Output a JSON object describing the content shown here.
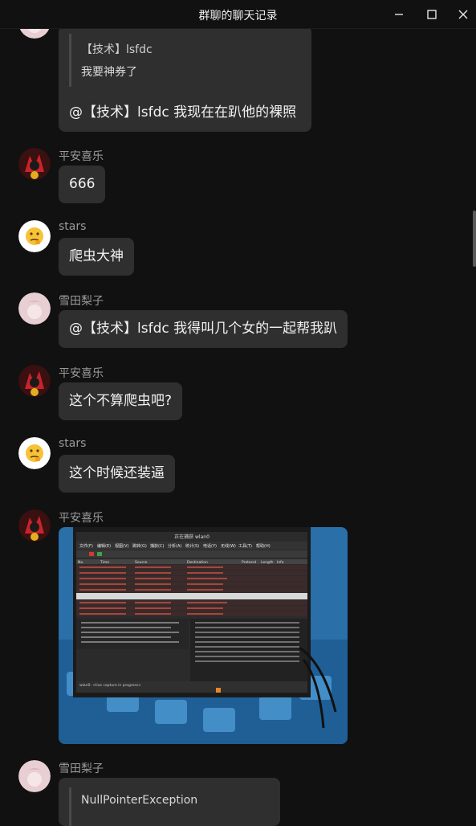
{
  "window": {
    "title": "群聊的聊天记录",
    "minimize_icon": "minimize-icon",
    "maximize_icon": "maximize-icon",
    "close_icon": "close-icon"
  },
  "messages": [
    {
      "quote_author": "【技术】lsfdc",
      "quote_text": "我要神券了",
      "text": "@【技术】lsfdc 我现在在趴他的裸照"
    },
    {
      "sender": "平安喜乐",
      "text": "666"
    },
    {
      "sender": "stars",
      "text": "爬虫大神"
    },
    {
      "sender": "雪田梨子",
      "text": "@【技术】lsfdc 我得叫几个女的一起帮我趴"
    },
    {
      "sender": "平安喜乐",
      "text": "这个不算爬虫吧?"
    },
    {
      "sender": "stars",
      "text": "这个时候还装逼"
    },
    {
      "sender": "平安喜乐",
      "image": "photo of laptop screen running Wireshark"
    },
    {
      "sender": "雪田梨子",
      "quote_text": "NullPointerException"
    }
  ],
  "photo": {
    "window_title": "正在捕获 wlan0",
    "menu": [
      "文件(F)",
      "编辑(E)",
      "视图(V)",
      "跳转(G)",
      "捕获(C)",
      "分析(A)",
      "统计(S)",
      "电话(Y)",
      "无线(W)",
      "工具(T)",
      "帮助(H)"
    ],
    "columns": [
      "No.",
      "Time",
      "Source",
      "Destination",
      "Protocol",
      "Length",
      "Info"
    ],
    "status": "wlan0: <live capture in progress>"
  },
  "colors": {
    "background": "#111111",
    "bubble": "#2f2f2f",
    "sender": "#9b9b9b",
    "text": "#f2f2f2"
  }
}
